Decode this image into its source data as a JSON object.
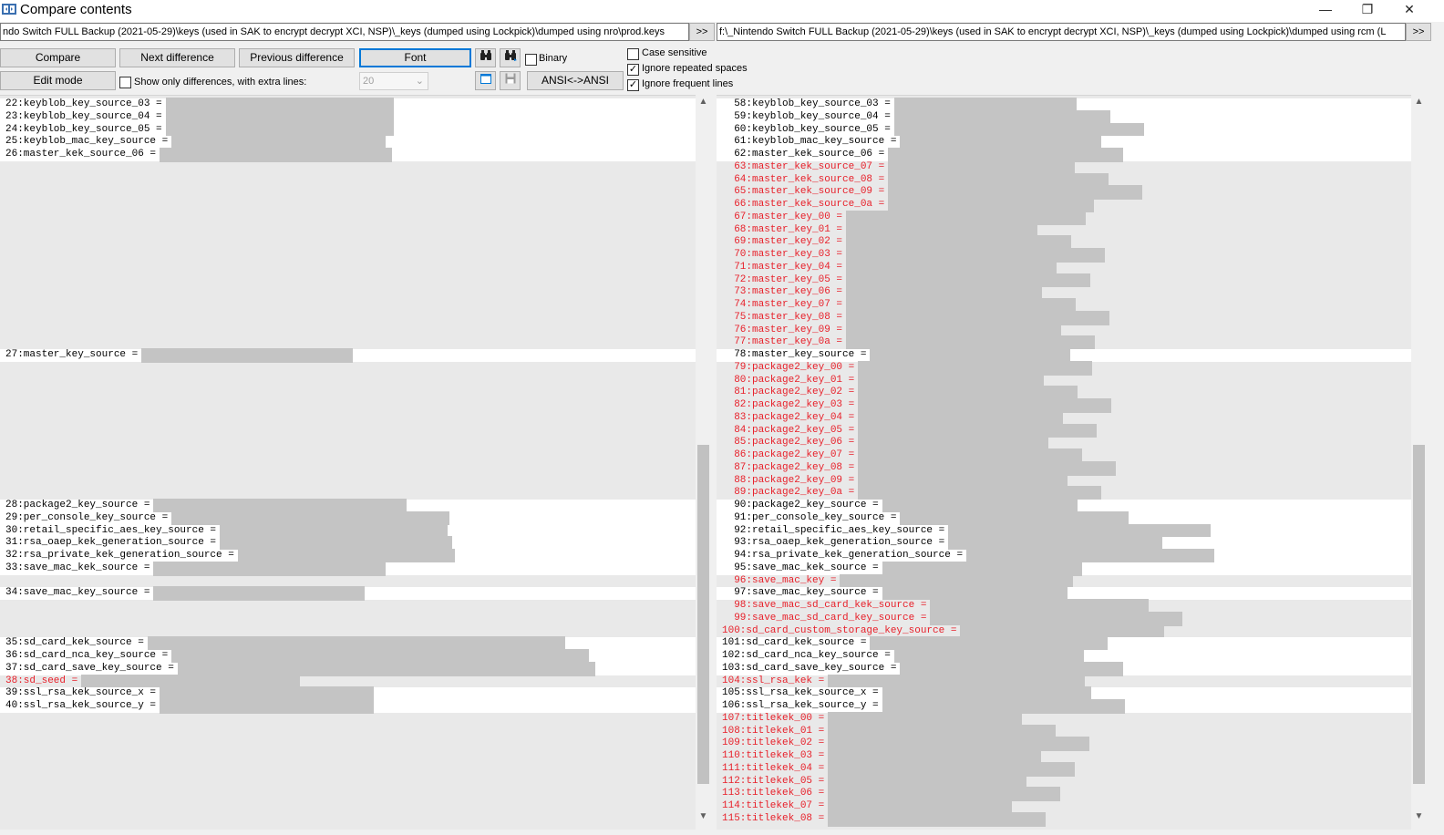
{
  "window": {
    "title": "Compare contents",
    "minimize": "—",
    "restore": "❐",
    "close": "✕"
  },
  "paths": {
    "left": "ndo Switch FULL Backup (2021-05-29)\\keys (used in SAK to encrypt decrypt XCI, NSP)\\_keys (dumped using Lockpick)\\dumped using nro\\prod.keys",
    "right": "f:\\_Nintendo Switch FULL Backup (2021-05-29)\\keys (used in SAK to encrypt decrypt XCI, NSP)\\_keys (dumped using Lockpick)\\dumped using rcm (L",
    "browse_label": ">>"
  },
  "toolbar": {
    "compare": "Compare",
    "next_difference": "Next difference",
    "previous_difference": "Previous difference",
    "font": "Font",
    "edit_mode": "Edit mode",
    "show_only_differences": "Show only differences, with extra lines:",
    "extra_lines_value": "20",
    "ansi": "ANSI<->ANSI",
    "binary": "Binary",
    "case_sensitive": "Case sensitive",
    "ignore_repeated_spaces": "Ignore repeated spaces",
    "ignore_frequent_lines": "Ignore frequent lines",
    "find_icon": "binoculars-icon",
    "find_next_icon": "binoculars-next-icon"
  },
  "checkboxes": {
    "binary": false,
    "show_only_differences": false,
    "case_sensitive": false,
    "ignore_repeated_spaces": true,
    "ignore_frequent_lines": true
  },
  "colors": {
    "diff_red": "#e8202a",
    "pane_gray": "#e9e9e9",
    "redaction_gray": "#c4c4c4",
    "focus_blue": "#0078d7"
  },
  "left_pane": {
    "lines": [
      {
        "row": 0,
        "text": "22:keyblob_key_source_03 =",
        "red": false
      },
      {
        "row": 1,
        "text": "23:keyblob_key_source_04 =",
        "red": false
      },
      {
        "row": 2,
        "text": "24:keyblob_key_source_05 =",
        "red": false
      },
      {
        "row": 3,
        "text": "25:keyblob_mac_key_source =",
        "red": false
      },
      {
        "row": 4,
        "text": "26:master_kek_source_06 =",
        "red": false
      },
      {
        "row": 20,
        "text": "27:master_key_source =",
        "red": false
      },
      {
        "row": 32,
        "text": "28:package2_key_source =",
        "red": false
      },
      {
        "row": 33,
        "text": "29:per_console_key_source =",
        "red": false
      },
      {
        "row": 34,
        "text": "30:retail_specific_aes_key_source =",
        "red": false
      },
      {
        "row": 35,
        "text": "31:rsa_oaep_kek_generation_source =",
        "red": false
      },
      {
        "row": 36,
        "text": "32:rsa_private_kek_generation_source =",
        "red": false
      },
      {
        "row": 37,
        "text": "33:save_mac_kek_source =",
        "red": false
      },
      {
        "row": 39,
        "text": "34:save_mac_key_source =",
        "red": false
      },
      {
        "row": 43,
        "text": "35:sd_card_kek_source =",
        "red": false
      },
      {
        "row": 44,
        "text": "36:sd_card_nca_key_source =",
        "red": false
      },
      {
        "row": 45,
        "text": "37:sd_card_save_key_source =",
        "red": false
      },
      {
        "row": 46,
        "text": "38:sd_seed =",
        "red": true
      },
      {
        "row": 47,
        "text": "39:ssl_rsa_kek_source_x =",
        "red": false
      },
      {
        "row": 48,
        "text": "40:ssl_rsa_kek_source_y =",
        "red": false
      }
    ]
  },
  "right_pane": {
    "lines": [
      {
        "row": 0,
        "text": "  58:keyblob_key_source_03 =",
        "red": false
      },
      {
        "row": 1,
        "text": "  59:keyblob_key_source_04 =",
        "red": false
      },
      {
        "row": 2,
        "text": "  60:keyblob_key_source_05 =",
        "red": false
      },
      {
        "row": 3,
        "text": "  61:keyblob_mac_key_source =",
        "red": false
      },
      {
        "row": 4,
        "text": "  62:master_kek_source_06 =",
        "red": false
      },
      {
        "row": 5,
        "text": "  63:master_kek_source_07 =",
        "red": true
      },
      {
        "row": 6,
        "text": "  64:master_kek_source_08 =",
        "red": true
      },
      {
        "row": 7,
        "text": "  65:master_kek_source_09 =",
        "red": true
      },
      {
        "row": 8,
        "text": "  66:master_kek_source_0a =",
        "red": true
      },
      {
        "row": 9,
        "text": "  67:master_key_00 =",
        "red": true
      },
      {
        "row": 10,
        "text": "  68:master_key_01 =",
        "red": true
      },
      {
        "row": 11,
        "text": "  69:master_key_02 =",
        "red": true
      },
      {
        "row": 12,
        "text": "  70:master_key_03 =",
        "red": true
      },
      {
        "row": 13,
        "text": "  71:master_key_04 =",
        "red": true
      },
      {
        "row": 14,
        "text": "  72:master_key_05 =",
        "red": true
      },
      {
        "row": 15,
        "text": "  73:master_key_06 =",
        "red": true
      },
      {
        "row": 16,
        "text": "  74:master_key_07 =",
        "red": true
      },
      {
        "row": 17,
        "text": "  75:master_key_08 =",
        "red": true
      },
      {
        "row": 18,
        "text": "  76:master_key_09 =",
        "red": true
      },
      {
        "row": 19,
        "text": "  77:master_key_0a =",
        "red": true
      },
      {
        "row": 20,
        "text": "  78:master_key_source =",
        "red": false
      },
      {
        "row": 21,
        "text": "  79:package2_key_00 =",
        "red": true
      },
      {
        "row": 22,
        "text": "  80:package2_key_01 =",
        "red": true
      },
      {
        "row": 23,
        "text": "  81:package2_key_02 =",
        "red": true
      },
      {
        "row": 24,
        "text": "  82:package2_key_03 =",
        "red": true
      },
      {
        "row": 25,
        "text": "  83:package2_key_04 =",
        "red": true
      },
      {
        "row": 26,
        "text": "  84:package2_key_05 =",
        "red": true
      },
      {
        "row": 27,
        "text": "  85:package2_key_06 =",
        "red": true
      },
      {
        "row": 28,
        "text": "  86:package2_key_07 =",
        "red": true
      },
      {
        "row": 29,
        "text": "  87:package2_key_08 =",
        "red": true
      },
      {
        "row": 30,
        "text": "  88:package2_key_09 =",
        "red": true
      },
      {
        "row": 31,
        "text": "  89:package2_key_0a =",
        "red": true
      },
      {
        "row": 32,
        "text": "  90:package2_key_source =",
        "red": false
      },
      {
        "row": 33,
        "text": "  91:per_console_key_source =",
        "red": false
      },
      {
        "row": 34,
        "text": "  92:retail_specific_aes_key_source =",
        "red": false
      },
      {
        "row": 35,
        "text": "  93:rsa_oaep_kek_generation_source =",
        "red": false
      },
      {
        "row": 36,
        "text": "  94:rsa_private_kek_generation_source =",
        "red": false
      },
      {
        "row": 37,
        "text": "  95:save_mac_kek_source =",
        "red": false
      },
      {
        "row": 38,
        "text": "  96:save_mac_key =",
        "red": true
      },
      {
        "row": 39,
        "text": "  97:save_mac_key_source =",
        "red": false
      },
      {
        "row": 40,
        "text": "  98:save_mac_sd_card_kek_source =",
        "red": true
      },
      {
        "row": 41,
        "text": "  99:save_mac_sd_card_key_source =",
        "red": true
      },
      {
        "row": 42,
        "text": "100:sd_card_custom_storage_key_source =",
        "red": true
      },
      {
        "row": 43,
        "text": "101:sd_card_kek_source =",
        "red": false
      },
      {
        "row": 44,
        "text": "102:sd_card_nca_key_source =",
        "red": false
      },
      {
        "row": 45,
        "text": "103:sd_card_save_key_source =",
        "red": false
      },
      {
        "row": 46,
        "text": "104:ssl_rsa_kek =",
        "red": true
      },
      {
        "row": 47,
        "text": "105:ssl_rsa_kek_source_x =",
        "red": false
      },
      {
        "row": 48,
        "text": "106:ssl_rsa_kek_source_y =",
        "red": false
      },
      {
        "row": 49,
        "text": "107:titlekek_00 =",
        "red": true
      },
      {
        "row": 50,
        "text": "108:titlekek_01 =",
        "red": true
      },
      {
        "row": 51,
        "text": "109:titlekek_02 =",
        "red": true
      },
      {
        "row": 52,
        "text": "110:titlekek_03 =",
        "red": true
      },
      {
        "row": 53,
        "text": "111:titlekek_04 =",
        "red": true
      },
      {
        "row": 54,
        "text": "112:titlekek_05 =",
        "red": true
      },
      {
        "row": 55,
        "text": "113:titlekek_06 =",
        "red": true
      },
      {
        "row": 56,
        "text": "114:titlekek_07 =",
        "red": true
      },
      {
        "row": 57,
        "text": "115:titlekek_08 =",
        "red": true
      }
    ]
  }
}
